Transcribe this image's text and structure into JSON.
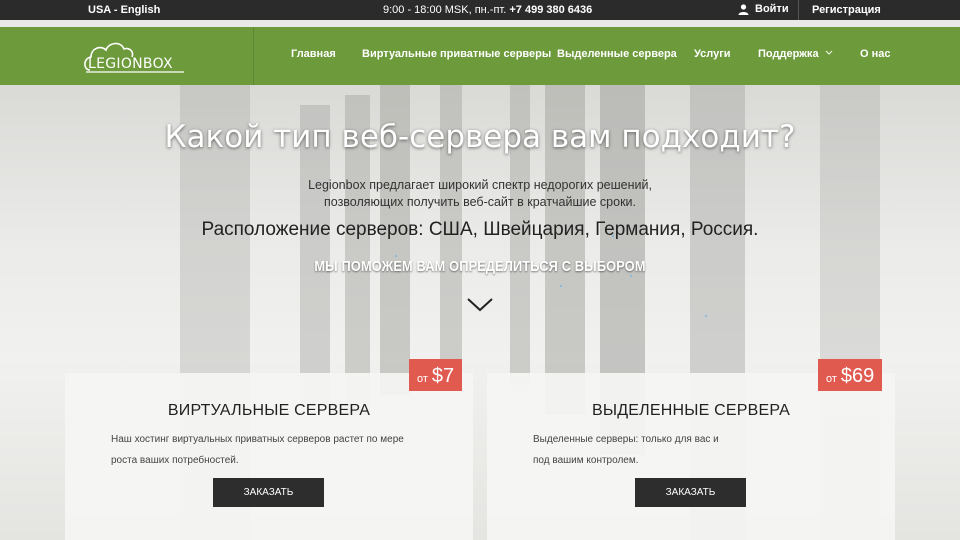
{
  "topbar": {
    "language": "USA - English",
    "hours": "9:00 - 18:00 MSK, пн.-пт.",
    "phone": "+7 499 380 6436",
    "login": "Войти",
    "register": "Регистрация"
  },
  "logo": {
    "text": "LEGIONBOX"
  },
  "nav": {
    "items": [
      {
        "label": "Главная"
      },
      {
        "label": "Виртуальные приватные серверы"
      },
      {
        "label": "Выделенные сервера"
      },
      {
        "label": "Услуги"
      },
      {
        "label": "Поддержка",
        "dropdown": true
      },
      {
        "label": "О нас"
      }
    ]
  },
  "hero": {
    "title": "Какой тип веб-сервера вам подходит?",
    "description_line1": "Legionbox предлагает широкий спектр недорогих решений,",
    "description_line2": "позволяющих получить веб-сайт в кратчайшие сроки.",
    "locations": "Расположение серверов: США, Швейцария, Германия, Россия.",
    "help": "МЫ ПОМОЖЕМ ВАМ ОПРЕДЕЛИТЬСЯ С ВЫБОРОМ"
  },
  "cards": [
    {
      "price_from": "от",
      "price": "$7",
      "title": "ВИРТУАЛЬНЫЕ СЕРВЕРА",
      "description_line1": "Наш хостинг виртуальных приватных серверов растет по мере",
      "description_line2": "роста ваших потребностей.",
      "button": "ЗАКАЗАТЬ"
    },
    {
      "price_from": "от",
      "price": "$69",
      "title": "ВЫДЕЛЕННЫЕ СЕРВЕРА",
      "description_line1": "Выделенные серверы: только для вас и",
      "description_line2": "под вашим контролем.",
      "button": "ЗАКАЗАТЬ"
    }
  ],
  "colors": {
    "topbar": "#2b2b2b",
    "navbar": "#6d9a3b",
    "price_badge": "#e05a4f",
    "button": "#2d2d2d"
  },
  "icons": [
    "user-icon",
    "cloud-logo-icon",
    "chevron-down-icon",
    "scroll-down-chevron-icon"
  ]
}
